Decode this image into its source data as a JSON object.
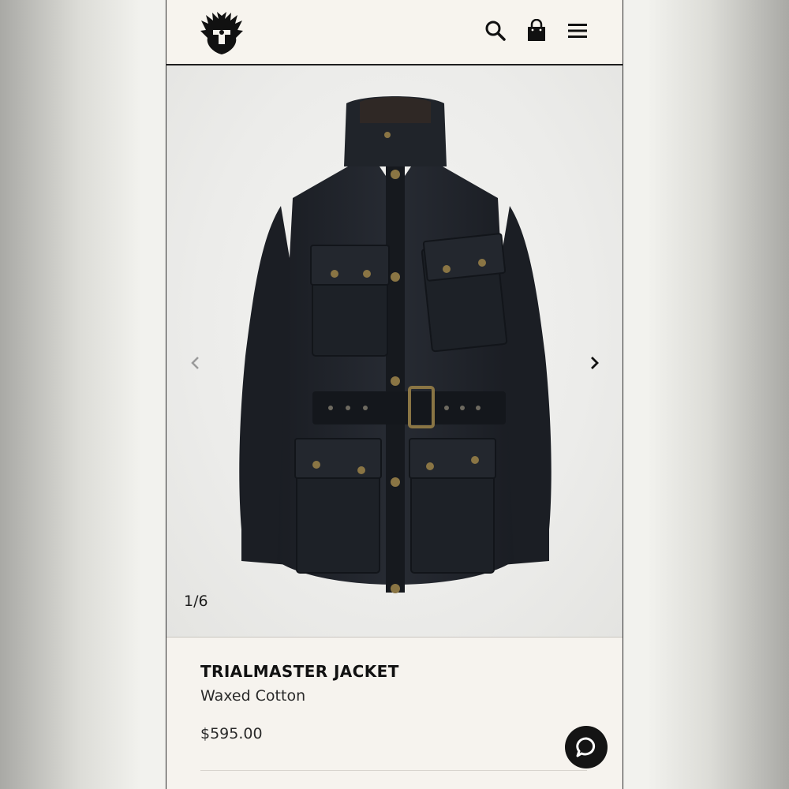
{
  "header": {
    "logo_icon": "phoenix-logo-icon",
    "search_icon": "search-icon",
    "bag_icon": "shopping-bag-icon",
    "menu_icon": "hamburger-menu-icon"
  },
  "gallery": {
    "counter": "1/6",
    "prev_icon": "chevron-left-icon",
    "next_icon": "chevron-right-icon",
    "current_index": 1,
    "total_images": 6
  },
  "product": {
    "title": "TRIALMASTER JACKET",
    "subtitle": "Waxed Cotton",
    "price": "$595.00"
  },
  "chat": {
    "icon": "chat-bubble-icon"
  },
  "colors": {
    "page_background": "#f6f3ee",
    "text": "#111111",
    "jacket": "#1f2329",
    "hardware": "#8a7544"
  }
}
